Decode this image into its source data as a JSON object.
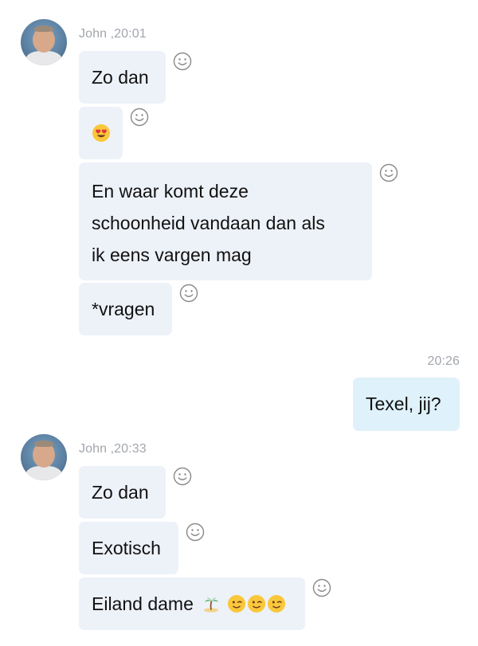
{
  "conversation": {
    "group1": {
      "sender_time": "John ,20:01",
      "messages": [
        {
          "text": "Zo dan"
        },
        {
          "emoji": "heart-eyes-emoji"
        },
        {
          "lines": [
            "En waar komt deze",
            "schoonheid vandaan dan als",
            "ik eens vargen mag"
          ]
        },
        {
          "text": "*vragen"
        }
      ]
    },
    "own": {
      "time": "20:26",
      "text": "Texel, jij?"
    },
    "group2": {
      "sender_time": "John ,20:33",
      "messages": [
        {
          "text": "Zo dan"
        },
        {
          "text": "Exotisch"
        },
        {
          "text": "Eiland dame",
          "emojis": [
            "desert-island-emoji",
            "winking-face-emoji",
            "winking-face-emoji",
            "winking-face-emoji"
          ]
        }
      ]
    }
  },
  "icons": {
    "reaction": "smiley-reaction-icon",
    "avatar": "avatar"
  },
  "colors": {
    "incoming_bubble": "#edf1f8",
    "outgoing_bubble": "#dff1fa",
    "meta_text": "#a2a6ad"
  }
}
